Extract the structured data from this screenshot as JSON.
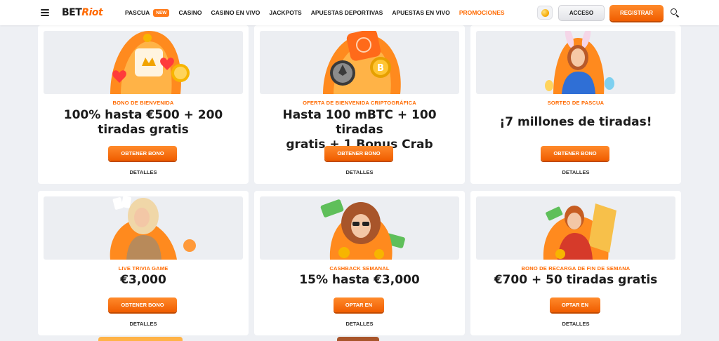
{
  "header": {
    "logo_bet": "BET",
    "logo_riot": "Riot",
    "nav": [
      {
        "label": "PASCUA",
        "badge": "NEW"
      },
      {
        "label": "CASINO"
      },
      {
        "label": "CASINO EN VIVO"
      },
      {
        "label": "JACKPOTS"
      },
      {
        "label": "APUESTAS DEPORTIVAS"
      },
      {
        "label": "APUESTAS EN VIVO"
      },
      {
        "label": "PROMOCIONES",
        "active": true
      }
    ],
    "login_label": "ACCESO",
    "register_label": "REGISTRAR"
  },
  "colors": {
    "accent": "#ff6a00",
    "card_bg": "#ffffff",
    "page_bg": "#eef0f4",
    "text": "#1b1b1b"
  },
  "promotions": [
    {
      "kicker": "BONO DE BIENVENIDA",
      "line1": "100% hasta €500 + 200",
      "line2": "tiradas gratis",
      "cta": "OBTENER BONO",
      "details": "DETALLES"
    },
    {
      "kicker": "OFERTA DE BIENVENIDA CRIPTOGRÁFICA",
      "line1": "Hasta 100 mBTC + 100 tiradas",
      "line2": "gratis + 1 Bonus Crab",
      "cta": "OBTENER BONO",
      "details": "DETALLES"
    },
    {
      "kicker": "SORTEO DE PASCUA",
      "line1": "¡7 millones de tiradas!",
      "cta": "OBTENER BONO",
      "details": "DETALLES"
    },
    {
      "kicker": "LIVE TRIVIA GAME",
      "line1": "€3,000",
      "cta": "OBTENER BONO",
      "details": "DETALLES"
    },
    {
      "kicker": "CASHBACK SEMANAL",
      "line1": "15% hasta €3,000",
      "cta": "OPTAR EN",
      "details": "DETALLES"
    },
    {
      "kicker": "BONO DE RECARGA DE FIN DE SEMANA",
      "line1": "€700 + 50 tiradas gratis",
      "cta": "OPTAR EN",
      "details": "DETALLES"
    }
  ]
}
